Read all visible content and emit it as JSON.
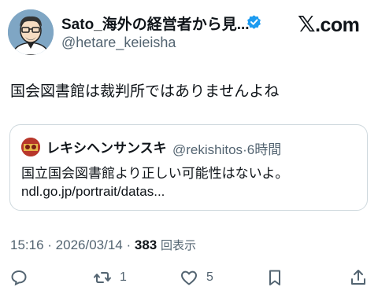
{
  "author": {
    "display_name": "Sato_海外の経営者から見...",
    "handle": "@hetare_keieisha",
    "verified": true
  },
  "brand": {
    "logo_text": ".com"
  },
  "post": {
    "text": "国会図書館は裁判所ではありませんよね"
  },
  "quoted_post": {
    "display_name": "レキシヘンサンスキ",
    "handle": "@rekishitos",
    "separator": "·",
    "time": "6時間",
    "text": "国立国会図書館より正しい可能性はないよ。",
    "link": "ndl.go.jp/portrait/datas..."
  },
  "meta": {
    "time": "15:16",
    "date": "2026/03/14",
    "views": "383",
    "views_label": "回表示"
  },
  "actions": {
    "reply_count": "",
    "repost_count": "1",
    "like_count": "5"
  },
  "colors": {
    "text": "#0f1419",
    "secondary": "#536471",
    "verified": "#1d9bf0",
    "border": "#cfd9de"
  }
}
